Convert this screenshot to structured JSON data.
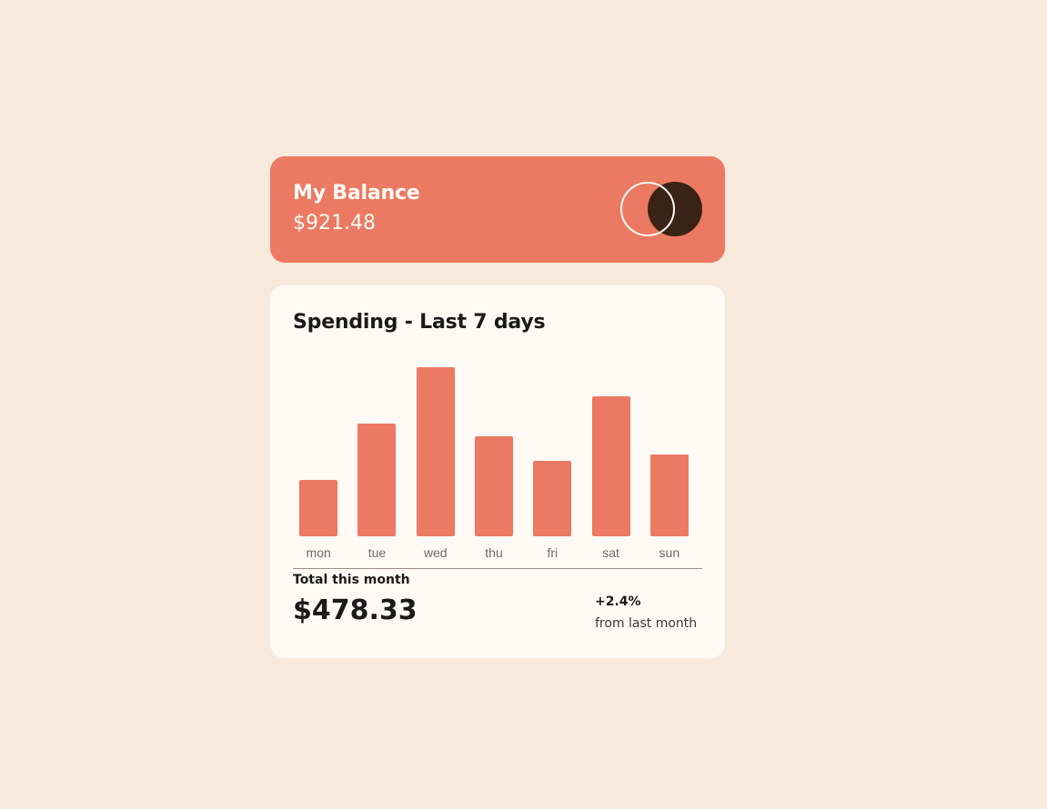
{
  "balance": {
    "title": "My Balance",
    "amount": "$921.48",
    "logo_icon": "circles-logo-icon"
  },
  "spending": {
    "title": "Spending - Last 7 days",
    "total_label": "Total this month",
    "total_amount": "$478.33",
    "change": "+2.4%",
    "change_label": "from last month"
  },
  "colors": {
    "background": "#f7e9dc",
    "accent": "#ec7961",
    "card": "#fffaf6",
    "dark": "#382314"
  },
  "chart_data": {
    "type": "bar",
    "categories": [
      "mon",
      "tue",
      "wed",
      "thu",
      "fri",
      "sat",
      "sun"
    ],
    "values": [
      17.45,
      34.91,
      52.36,
      31.07,
      23.39,
      43.28,
      25.48
    ],
    "title": "",
    "xlabel": "",
    "ylabel": "",
    "ylim": [
      0,
      52.36
    ]
  }
}
